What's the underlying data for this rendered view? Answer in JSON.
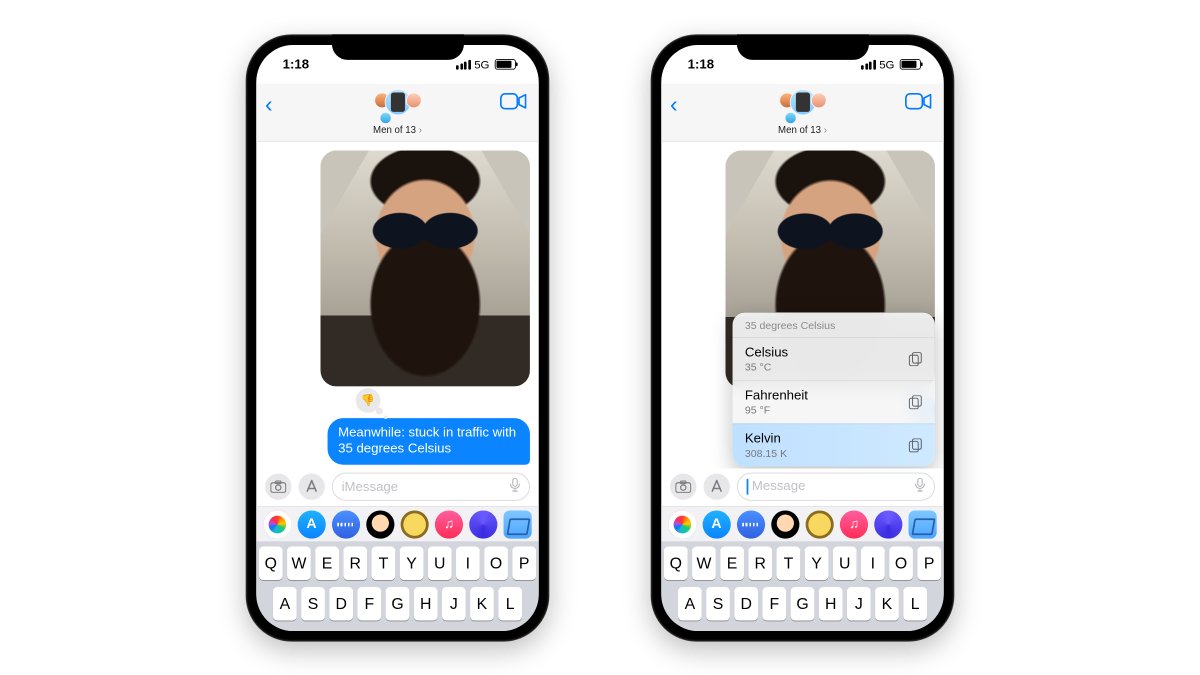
{
  "status": {
    "time": "1:18",
    "network": "5G"
  },
  "header": {
    "chat_name": "Men of 13",
    "back_icon": "‹",
    "facetime_icon": "facetime"
  },
  "left": {
    "tapback": "👎",
    "message": "Meanwhile: stuck in traffic with 35 degrees Celsius",
    "input_placeholder": "iMessage"
  },
  "right": {
    "input_placeholder": "Message",
    "popup": {
      "title": "35 degrees Celsius",
      "rows": [
        {
          "unit": "Celsius",
          "value": "35 °C"
        },
        {
          "unit": "Fahrenheit",
          "value": "95 °F"
        },
        {
          "unit": "Kelvin",
          "value": "308.15 K"
        }
      ]
    }
  },
  "keyboard": {
    "row1": [
      "Q",
      "W",
      "E",
      "R",
      "T",
      "Y",
      "U",
      "I",
      "O",
      "P"
    ],
    "row2": [
      "A",
      "S",
      "D",
      "F",
      "G",
      "H",
      "J",
      "K",
      "L"
    ]
  },
  "icons": {
    "camera": "camera-icon",
    "apps": "apps-icon",
    "mic": "mic-icon",
    "copy": "copy-icon"
  }
}
